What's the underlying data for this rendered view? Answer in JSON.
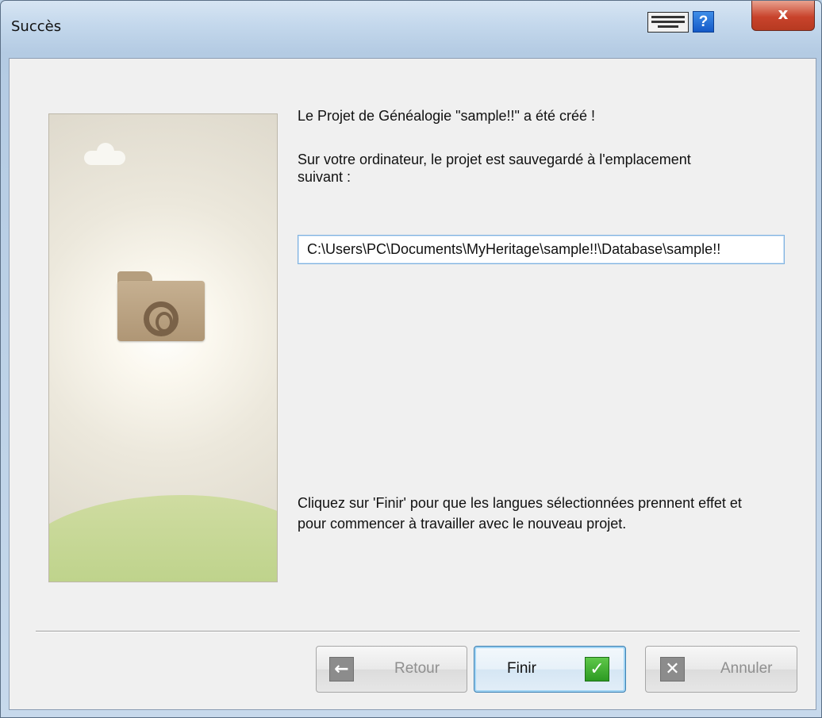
{
  "window": {
    "title": "Succès",
    "close_glyph": "x",
    "help_glyph": "?",
    "icons": [
      "keyboard-icon",
      "help-icon",
      "close-icon"
    ]
  },
  "content": {
    "created_message": "Le Projet de Généalogie \"sample!!\" a été créé !",
    "location_message": "Sur votre ordinateur, le projet est sauvegardé à l'emplacement suivant :",
    "path_value": "C:\\Users\\PC\\Documents\\MyHeritage\\sample!!\\Database\\sample!!",
    "finish_message": "Cliquez sur 'Finir' pour que les langues sélectionnées prennent effet et pour commencer à travailler avec le nouveau projet."
  },
  "buttons": {
    "back": {
      "label": "Retour",
      "icon": "arrow-left-icon",
      "glyph": "←"
    },
    "finish": {
      "label": "Finir",
      "icon": "checkmark-icon",
      "glyph": "✓"
    },
    "cancel": {
      "label": "Annuler",
      "icon": "x-icon",
      "glyph": "✕"
    }
  },
  "colors": {
    "title_bar": "#c4d8ec",
    "client_background": "#f0f0f0",
    "field_border": "#7fb2e0",
    "close_button": "#c8432c",
    "finish_check": "#2c9a22"
  }
}
